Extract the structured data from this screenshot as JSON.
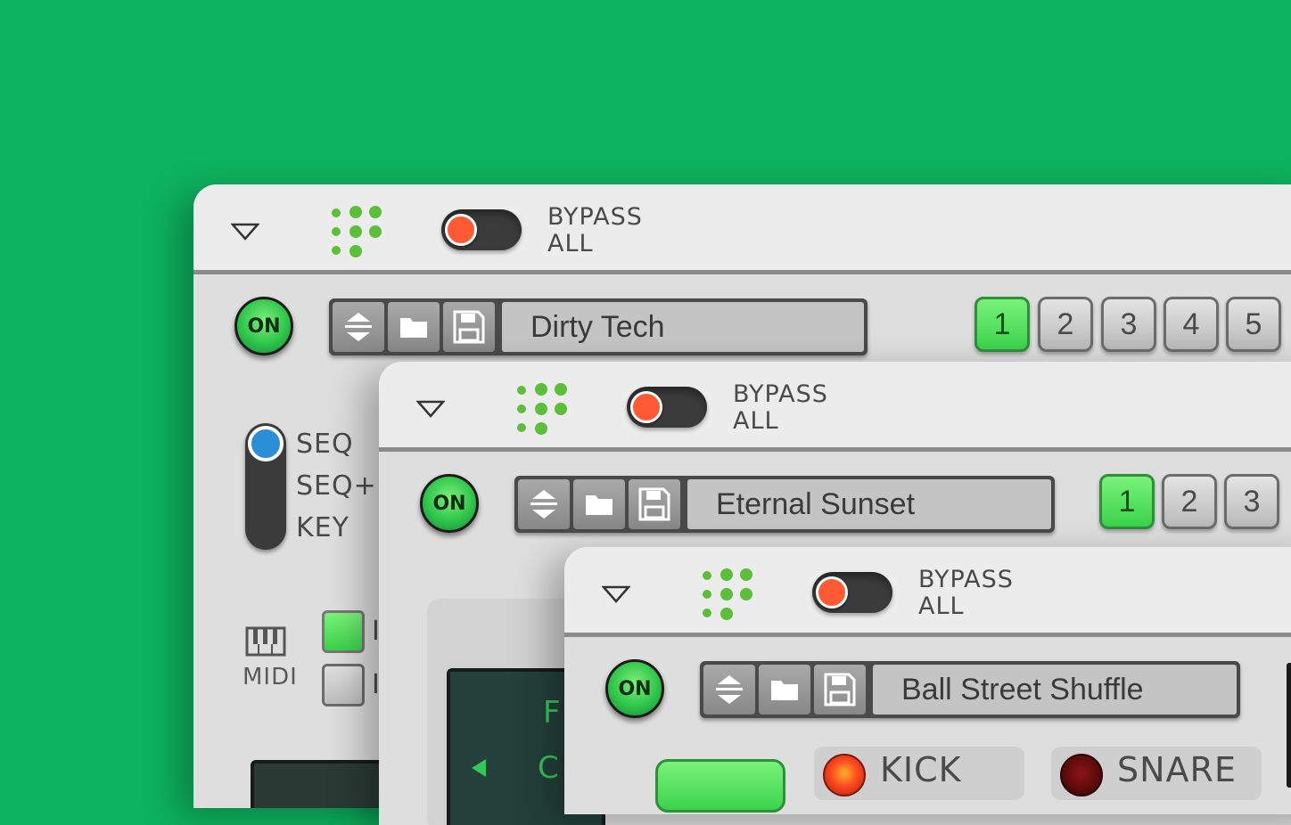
{
  "colors": {
    "background": "#0db35f",
    "accent_green": "#3bd34b",
    "bypass_knob": "#ff5a33",
    "mode_knob": "#2b8fd8"
  },
  "panels": [
    {
      "bypass_label": "BYPASS\nALL",
      "on_label": "ON",
      "preset_name": "Dirty Tech",
      "slots": [
        "1",
        "2",
        "3",
        "4",
        "5"
      ],
      "active_slot": "1",
      "mode_options": [
        "SEQ",
        "SEQ+K",
        "KEY"
      ],
      "midi_label": "MIDI",
      "partial_text": [
        "I",
        "I"
      ]
    },
    {
      "bypass_label": "BYPASS\nALL",
      "on_label": "ON",
      "preset_name": "Eternal Sunset",
      "slots": [
        "1",
        "2",
        "3"
      ],
      "active_slot": "1",
      "display_text": [
        "F",
        "C"
      ]
    },
    {
      "bypass_label": "BYPASS\nALL",
      "on_label": "ON",
      "preset_name": "Ball Street Shuffle",
      "channels": [
        "KICK",
        "SNARE"
      ]
    }
  ],
  "icons": [
    "menu-triangle-icon",
    "logo-dots-icon",
    "up-down-arrows-icon",
    "folder-icon",
    "save-floppy-icon",
    "midi-keyboard-icon"
  ]
}
